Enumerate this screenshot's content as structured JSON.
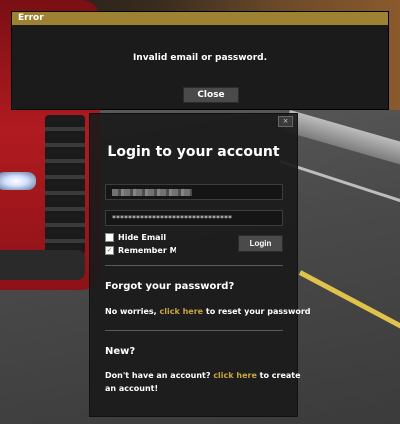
{
  "error_dialog": {
    "title": "Error",
    "message": "Invalid email or password.",
    "close_label": "Close"
  },
  "login": {
    "title": "Login to your account",
    "panel_close": "×",
    "email_value": "",
    "password_value": "******************************",
    "hide_email_label": "Hide Email",
    "hide_email_checked": false,
    "remember_me_label": "Remember Me",
    "remember_me_checked": true,
    "login_button": "Login"
  },
  "forgot": {
    "heading": "Forgot your password?",
    "prefix": "No worries, ",
    "link": "click here",
    "suffix": " to reset your password"
  },
  "new_account": {
    "heading": "New?",
    "prefix": "Don't have an account? ",
    "link": "click here",
    "suffix": " to create",
    "line2": "an account!"
  },
  "colors": {
    "accent": "#9e8234",
    "link": "#c9a53f",
    "panel_bg": "#1a1a1a"
  }
}
